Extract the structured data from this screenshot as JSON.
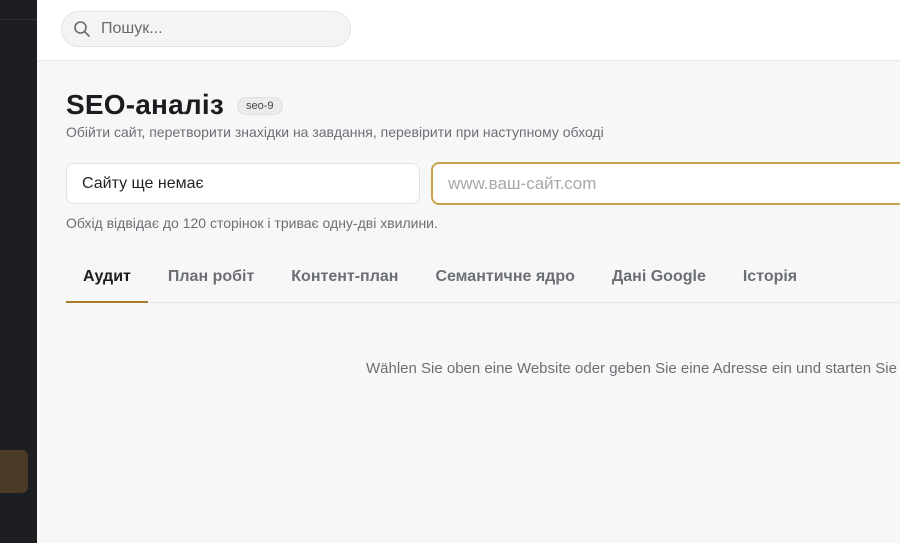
{
  "search": {
    "placeholder": "Пошук..."
  },
  "page": {
    "title": "SEO-аналіз",
    "tag": "seo-9",
    "subtitle": "Обійти сайт, перетворити знахідки на завдання, перевірити при наступному обході"
  },
  "site_select": {
    "value": "Сайту ще немає"
  },
  "url_input": {
    "placeholder": "www.ваш-сайт.com"
  },
  "hint": "Обхід відвідає до 120 сторінок і триває одну-дві хвилини.",
  "tabs": [
    {
      "label": "Аудит",
      "active": true
    },
    {
      "label": "План робіт",
      "active": false
    },
    {
      "label": "Контент-план",
      "active": false
    },
    {
      "label": "Семантичне ядро",
      "active": false
    },
    {
      "label": "Дані Google",
      "active": false
    },
    {
      "label": "Історія",
      "active": false
    }
  ],
  "empty_state": "Wählen Sie oben eine Website oder geben Sie eine Adresse ein und starten Sie den",
  "colors": {
    "accent": "#a8792a",
    "input_focus_border": "#c9a24a",
    "sidebar_bg": "#1c1e22"
  }
}
